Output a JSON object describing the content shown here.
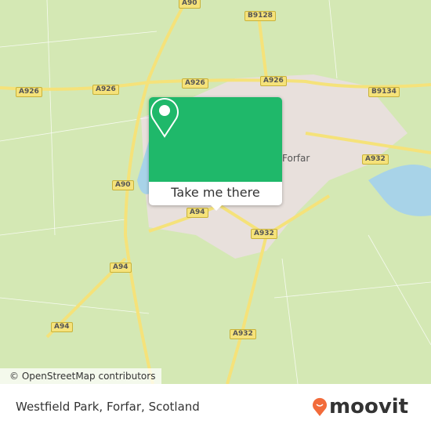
{
  "map": {
    "road_labels": [
      "A90",
      "B9128",
      "A926",
      "A926",
      "A926",
      "A926",
      "B9134",
      "A932",
      "A90",
      "A94",
      "A932",
      "A94",
      "A94",
      "A932"
    ],
    "town": "Forfar",
    "attribution": "© OpenStreetMap contributors",
    "colors": {
      "land": "#d4e8b4",
      "road": "#f5e27a",
      "water": "#a8d3e8",
      "urban": "#e8e0dc"
    }
  },
  "popup": {
    "button": "Take me there",
    "icon": "map-pin-icon",
    "color": "#1fb86a"
  },
  "footer": {
    "place": "Westfield Park, Forfar, Scotland",
    "brand": "moovit",
    "brand_color": "#f26b3a"
  }
}
